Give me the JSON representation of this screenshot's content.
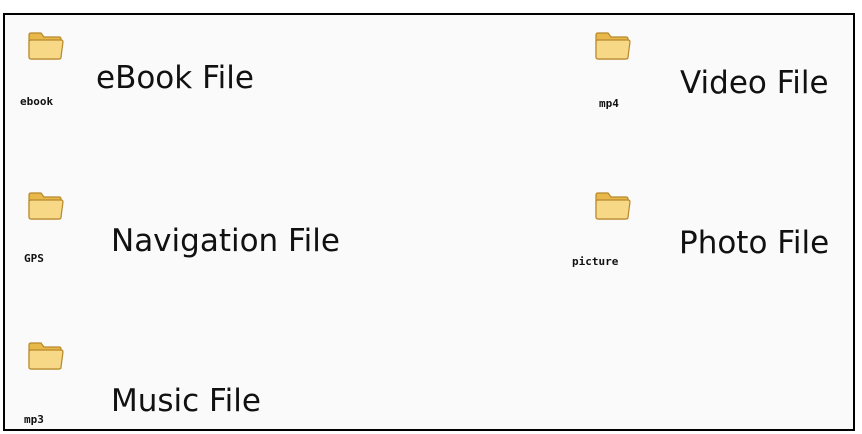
{
  "folders": [
    {
      "caption": "ebook",
      "label": "eBook File",
      "icon": "folder-icon"
    },
    {
      "caption": "mp4",
      "label": "Video File",
      "icon": "folder-icon"
    },
    {
      "caption": "GPS",
      "label": "Navigation File",
      "icon": "folder-icon"
    },
    {
      "caption": "picture",
      "label": "Photo File",
      "icon": "folder-icon"
    },
    {
      "caption": "mp3",
      "label": "Music File",
      "icon": "folder-icon"
    }
  ],
  "colors": {
    "folder_fill": "#f4d27a",
    "folder_outline": "#b8882a",
    "border": "#000000"
  }
}
